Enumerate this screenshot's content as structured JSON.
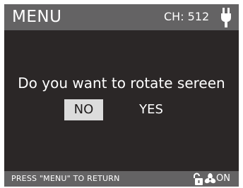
{
  "header": {
    "title": "MENU",
    "channel": "CH: 512",
    "icon": "plug-icon"
  },
  "dialog": {
    "question": "Do you want to rotate sereen",
    "no_label": "NO",
    "yes_label": "YES",
    "selected": "NO"
  },
  "footer": {
    "hint": "PRESS \"MENU\" TO RETURN",
    "lock_icon": "unlocked-padlock-icon",
    "fan_icon": "fan-icon",
    "fan_status": "ON"
  },
  "colors": {
    "screen_background": "#2b2727",
    "bar_background": "#646364",
    "selected_background": "#dcdcdc",
    "text": "#ffffff"
  }
}
